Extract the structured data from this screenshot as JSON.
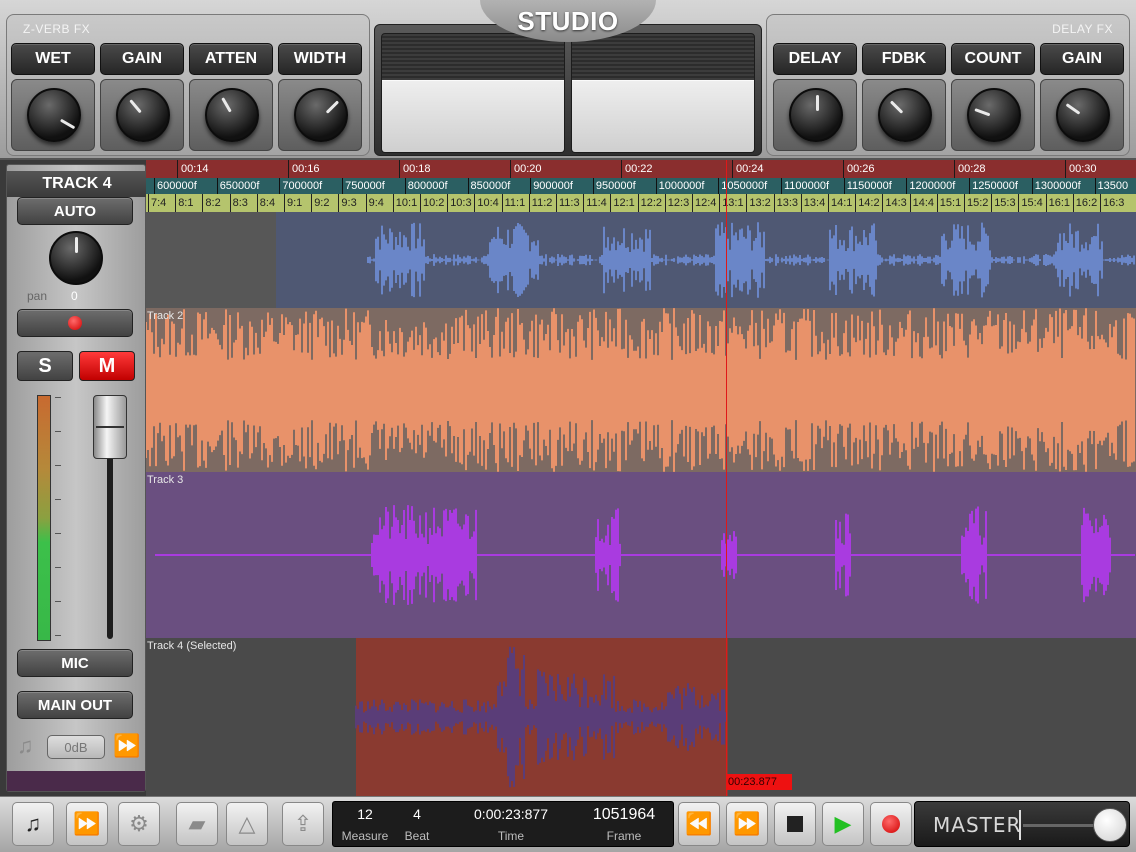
{
  "app": {
    "title": "STUDIO"
  },
  "fx_left": {
    "label": "Z-VERB FX",
    "knobs": [
      {
        "label": "WET"
      },
      {
        "label": "GAIN"
      },
      {
        "label": "ATTEN"
      },
      {
        "label": "WIDTH"
      }
    ]
  },
  "fx_right": {
    "label": "DELAY FX",
    "knobs": [
      {
        "label": "DELAY"
      },
      {
        "label": "FDBK"
      },
      {
        "label": "COUNT"
      },
      {
        "label": "GAIN"
      }
    ]
  },
  "track_panel": {
    "title": "TRACK 4",
    "auto_label": "AUTO",
    "pan_label": "pan",
    "pan_value": "0",
    "solo_label": "S",
    "mute_label": "M",
    "input_label": "MIC",
    "output_label": "MAIN OUT",
    "gain_label": "0dB",
    "colors": {
      "mute_active": "#e01515"
    }
  },
  "ruler": {
    "times": [
      "00:14",
      "00:16",
      "00:18",
      "00:20",
      "00:22",
      "00:24",
      "00:26",
      "00:28",
      "00:30"
    ],
    "frames": [
      "600000f",
      "650000f",
      "700000f",
      "750000f",
      "800000f",
      "850000f",
      "900000f",
      "950000f",
      "1000000f",
      "1050000f",
      "1100000f",
      "1150000f",
      "1200000f",
      "1250000f",
      "1300000f",
      "13500"
    ],
    "beats": [
      "7:4",
      "8:1",
      "8:2",
      "8:3",
      "8:4",
      "9:1",
      "9:2",
      "9:3",
      "9:4",
      "10:1",
      "10:2",
      "10:3",
      "10:4",
      "11:1",
      "11:2",
      "11:3",
      "11:4",
      "12:1",
      "12:2",
      "12:3",
      "12:4",
      "13:1",
      "13:2",
      "13:3",
      "13:4",
      "14:1",
      "14:2",
      "14:3",
      "14:4",
      "15:1",
      "15:2",
      "15:3",
      "15:4",
      "16:1",
      "16:2",
      "16:3"
    ]
  },
  "tracks": [
    {
      "label": "",
      "color": "#6a86c8",
      "bg": "#4f5873"
    },
    {
      "label": "Track 2",
      "color": "#e8926a",
      "bg": "#7d6a62"
    },
    {
      "label": "Track 3",
      "color": "#a93be0",
      "bg": "#6a4f80"
    },
    {
      "label": "Track 4 (Selected)",
      "color": "#5a3d78",
      "bg": "#8a3a30"
    }
  ],
  "playhead": {
    "time": "00:23.877",
    "color": "#e01818"
  },
  "transport": {
    "measure": "12",
    "measure_label": "Measure",
    "beat": "4",
    "beat_label": "Beat",
    "time": "0:00:23:877",
    "time_label": "Time",
    "frame": "1051964",
    "frame_label": "Frame",
    "master_label": "MASTER"
  },
  "icons": {
    "library": "music-note-icon",
    "fx": "fast-forward-icon",
    "settings": "gear-icon",
    "files": "folder-icon",
    "metronome": "metronome-icon",
    "share": "share-icon",
    "rewind": "rewind-icon",
    "forward": "fast-forward-icon",
    "stop": "stop-icon",
    "play": "play-icon",
    "record": "record-icon"
  }
}
